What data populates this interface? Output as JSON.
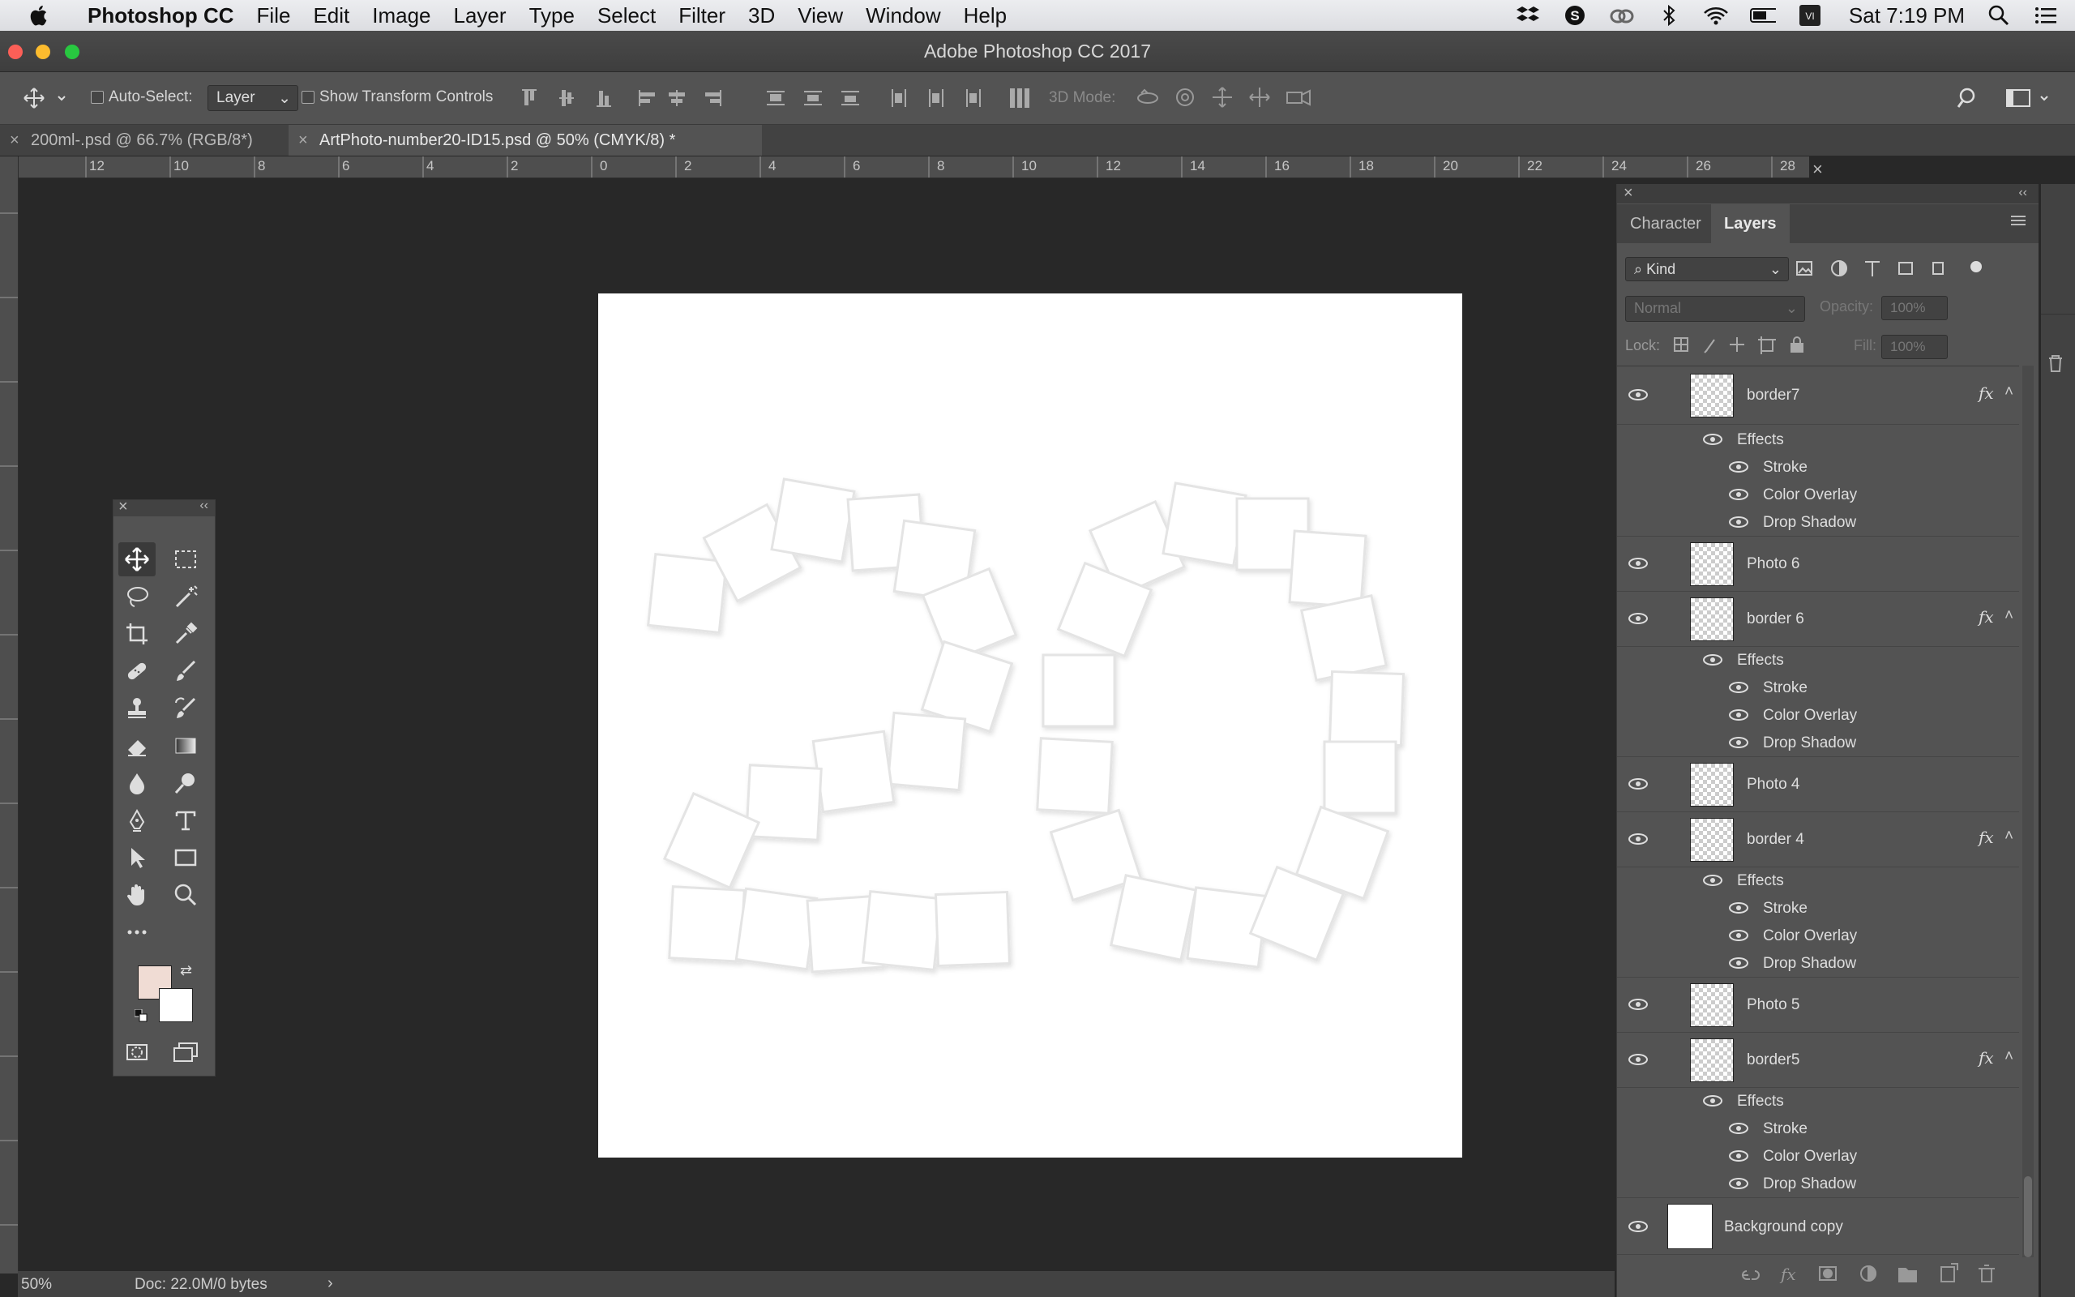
{
  "menubar": {
    "app_name": "Photoshop CC",
    "items": [
      "File",
      "Edit",
      "Image",
      "Layer",
      "Type",
      "Select",
      "Filter",
      "3D",
      "View",
      "Window",
      "Help"
    ],
    "clock": "Sat 7:19 PM",
    "status_icons": [
      "dropbox-icon",
      "skype-icon",
      "creative-cloud-icon",
      "bluetooth-icon",
      "wifi-icon",
      "battery-icon",
      "input-source-icon",
      "search-icon",
      "notification-list-icon"
    ]
  },
  "window": {
    "title": "Adobe Photoshop CC 2017"
  },
  "options": {
    "auto_select_label": "Auto-Select:",
    "auto_select_value": "Layer",
    "show_transform_label": "Show Transform Controls",
    "mode_3d_label": "3D Mode:"
  },
  "tabs": [
    {
      "label": "200ml-.psd @ 66.7% (RGB/8*)",
      "active": false
    },
    {
      "label": "ArtPhoto-number20-ID15.psd @ 50% (CMYK/8) *",
      "active": true
    }
  ],
  "ruler": {
    "h_labels": [
      "12",
      "10",
      "8",
      "6",
      "4",
      "2",
      "0",
      "2",
      "4",
      "6",
      "8",
      "10",
      "12",
      "14",
      "16",
      "18",
      "20",
      "22",
      "24",
      "26",
      "28"
    ]
  },
  "tools": {
    "foreground_color": "#f0dcd4",
    "background_color": "#ffffff"
  },
  "panel": {
    "tab_character": "Character",
    "tab_layers": "Layers",
    "kind_label": "Kind",
    "blend_mode": "Normal",
    "opacity_label": "Opacity:",
    "opacity_value": "100%",
    "lock_label": "Lock:",
    "fill_label": "Fill:",
    "fill_value": "100%",
    "layers": [
      {
        "name": "border7",
        "fx": true,
        "effects": [
          "Stroke",
          "Color Overlay",
          "Drop Shadow"
        ]
      },
      {
        "name": "Photo 6",
        "fx": false
      },
      {
        "name": "border 6",
        "fx": true,
        "effects": [
          "Stroke",
          "Color Overlay",
          "Drop Shadow"
        ]
      },
      {
        "name": "Photo 4",
        "fx": false
      },
      {
        "name": "border 4",
        "fx": true,
        "effects": [
          "Stroke",
          "Color Overlay",
          "Drop Shadow"
        ]
      },
      {
        "name": "Photo 5",
        "fx": false
      },
      {
        "name": "border5",
        "fx": true,
        "effects": [
          "Stroke",
          "Color Overlay",
          "Drop Shadow"
        ]
      },
      {
        "name": "Background copy",
        "fx": false
      }
    ],
    "effects_label": "Effects",
    "fx_label": "fx"
  },
  "statusbar": {
    "zoom": "50%",
    "doc_info": "Doc: 22.0M/0 bytes"
  }
}
